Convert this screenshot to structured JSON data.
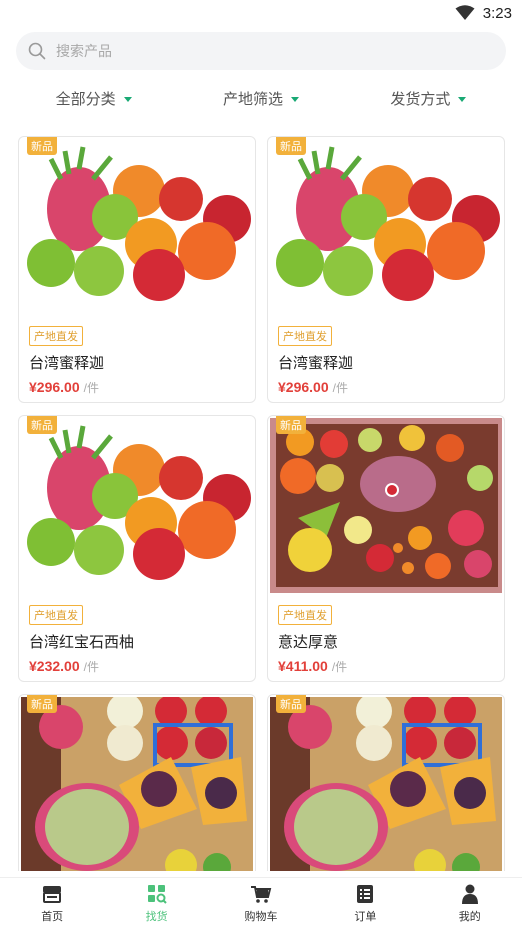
{
  "status": {
    "time": "3:23"
  },
  "search": {
    "placeholder": "搜索产品"
  },
  "filters": [
    "全部分类",
    "产地筛选",
    "发货方式"
  ],
  "products": [
    {
      "badge": "新品",
      "tag": "产地直发",
      "name": "台湾蜜释迦",
      "price": "¥296.00",
      "unit": "/件",
      "image": "mixed-fruit-pile"
    },
    {
      "badge": "新品",
      "tag": "产地直发",
      "name": "台湾蜜释迦",
      "price": "¥296.00",
      "unit": "/件",
      "image": "mixed-fruit-pile"
    },
    {
      "badge": "新品",
      "tag": "产地直发",
      "name": "台湾红宝石西柚",
      "price": "¥232.00",
      "unit": "/件",
      "image": "mixed-fruit-pile"
    },
    {
      "badge": "新品",
      "tag": "产地直发",
      "name": "意达厚意",
      "price": "¥411.00",
      "unit": "/件",
      "image": "fruit-gift-box"
    },
    {
      "badge": "新品",
      "image": "melon-fruit-box"
    },
    {
      "badge": "新品",
      "image": "melon-fruit-box"
    }
  ],
  "nav": [
    {
      "label": "首页",
      "icon": "shop-icon",
      "active": false
    },
    {
      "label": "找货",
      "icon": "find-goods-icon",
      "active": true
    },
    {
      "label": "购物车",
      "icon": "cart-icon",
      "active": false
    },
    {
      "label": "订单",
      "icon": "order-list-icon",
      "active": false
    },
    {
      "label": "我的",
      "icon": "user-icon",
      "active": false
    }
  ],
  "colors": {
    "accent": "#4cc27b",
    "price": "#e2403a",
    "badge": "#f2b13b",
    "caret": "#19a974"
  }
}
